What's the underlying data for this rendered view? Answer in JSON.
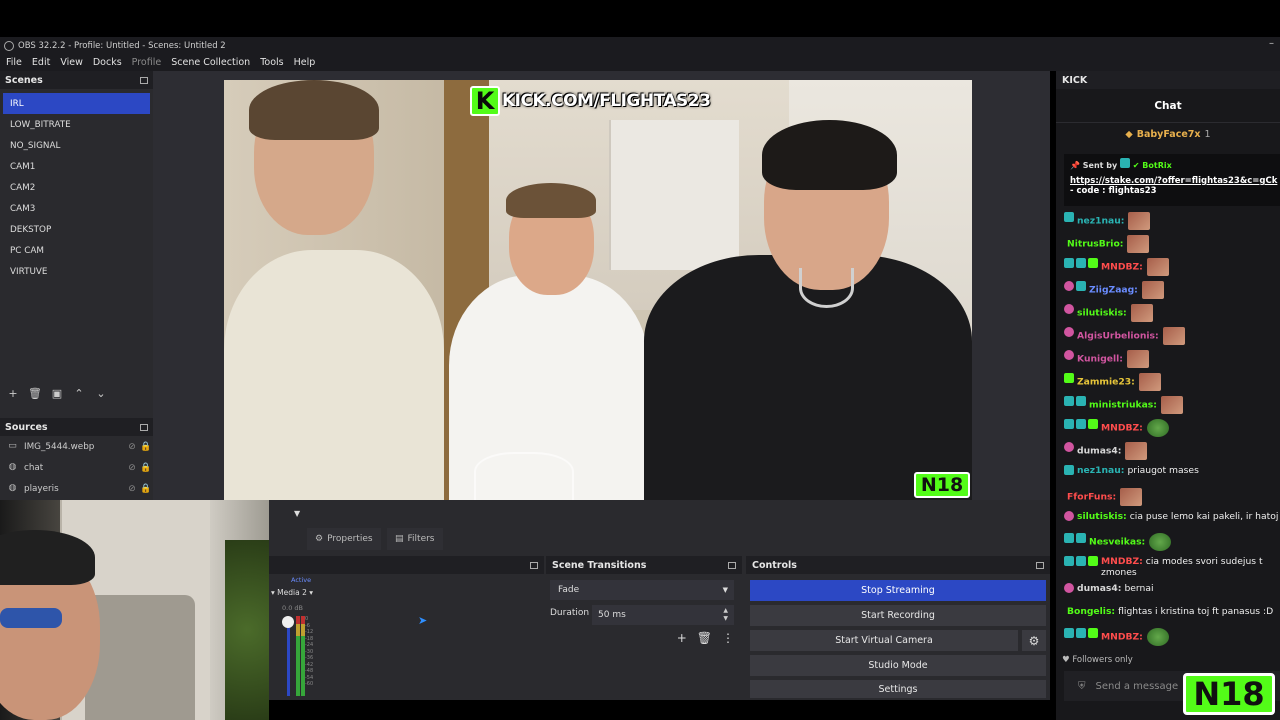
{
  "window": {
    "title": "OBS 32.2.2 - Profile: Untitled - Scenes: Untitled 2"
  },
  "menu": [
    "File",
    "Edit",
    "View",
    "Docks",
    "Profile",
    "Scene Collection",
    "Tools",
    "Help"
  ],
  "scenes": {
    "header": "Scenes",
    "items": [
      "IRL",
      "LOW_BITRATE",
      "NO_SIGNAL",
      "CAM1",
      "CAM2",
      "CAM3",
      "DEKSTOP",
      "PC CAM",
      "VIRTUVE"
    ],
    "selected": "IRL"
  },
  "sources": {
    "header": "Sources",
    "items": [
      {
        "name": "IMG_5444.webp",
        "icon": "image-icon"
      },
      {
        "name": "chat",
        "icon": "globe-icon"
      },
      {
        "name": "playeris",
        "icon": "globe-icon"
      }
    ]
  },
  "preview": {
    "kick_logo": "K",
    "kick_url": "KICK.COM/FLIGHTAS23",
    "n18_label": "N18"
  },
  "source_toolbar": {
    "properties": "Properties",
    "filters": "Filters"
  },
  "mixer": {
    "active_label": "Active",
    "track_name": "Media 2",
    "db": "0.0 dB",
    "ticks": [
      "0",
      "-6",
      "-12",
      "-18",
      "-24",
      "-30",
      "-36",
      "-42",
      "-48",
      "-54",
      "-60"
    ]
  },
  "transitions": {
    "header": "Scene Transitions",
    "selected": "Fade",
    "duration_label": "Duration",
    "duration_value": "50 ms"
  },
  "controls": {
    "header": "Controls",
    "stop_streaming": "Stop Streaming",
    "start_recording": "Start Recording",
    "start_virtual_camera": "Start Virtual Camera",
    "studio_mode": "Studio Mode",
    "settings": "Settings"
  },
  "chat": {
    "dock_title": "KICK",
    "title": "Chat",
    "pinned_user": "BabyFace7x",
    "pinned_count": "1",
    "sent_by_label": "Sent by",
    "bot_name": "BotRix",
    "link": "https://stake.com/?offer=flightas23&c=gCk",
    "code": "- code : flightas23",
    "messages": [
      {
        "user": "nez1nau:",
        "text": "",
        "color": "#2ab3b3",
        "badges": [
          "teal"
        ],
        "emote": true
      },
      {
        "user": "NitrusBrio:",
        "text": "",
        "color": "#53fc18",
        "badges": [],
        "emote": true
      },
      {
        "user": "MNDBZ:",
        "text": "",
        "color": "#ff4d4d",
        "badges": [
          "teal",
          "teal",
          "green"
        ],
        "emote": true
      },
      {
        "user": "ZiigZaag:",
        "text": "",
        "color": "#6a8cff",
        "badges": [
          "pink",
          "teal"
        ],
        "emote": true
      },
      {
        "user": "silutiskis:",
        "text": "",
        "color": "#53fc18",
        "badges": [
          "pink"
        ],
        "emote": true
      },
      {
        "user": "AlgisUrbelionis:",
        "text": "",
        "color": "#d155a0",
        "badges": [
          "pink"
        ],
        "emote": true
      },
      {
        "user": "Kunigell:",
        "text": "",
        "color": "#d155a0",
        "badges": [
          "pink"
        ],
        "emote": true
      },
      {
        "user": "Zammie23:",
        "text": "",
        "color": "#e8c63a",
        "badges": [
          "green"
        ],
        "emote": true
      },
      {
        "user": "ministriukas:",
        "text": "",
        "color": "#53fc18",
        "badges": [
          "teal",
          "teal"
        ],
        "emote": true
      },
      {
        "user": "MNDBZ:",
        "text": "",
        "color": "#ff4d4d",
        "badges": [
          "teal",
          "teal",
          "green"
        ],
        "emote": true,
        "pepe": true
      },
      {
        "user": "dumas4:",
        "text": "",
        "color": "#d8d8d8",
        "badges": [
          "pink"
        ],
        "emote": true
      },
      {
        "user": "nez1nau:",
        "text": "priaugot mases",
        "color": "#2ab3b3",
        "badges": [
          "teal"
        ],
        "emote": false
      },
      {
        "user": "FforFuns:",
        "text": "",
        "color": "#ff4d4d",
        "badges": [],
        "emote": true
      },
      {
        "user": "silutiskis:",
        "text": "cia puse lemo kai pakeli, ir hatoj",
        "color": "#53fc18",
        "badges": [
          "pink"
        ],
        "emote": false
      },
      {
        "user": "Nesveikas:",
        "text": "",
        "color": "#53fc18",
        "badges": [
          "teal",
          "teal"
        ],
        "emote": true,
        "pepe": true
      },
      {
        "user": "MNDBZ:",
        "text": "cia modes svori sudejus t zmones",
        "color": "#ff4d4d",
        "badges": [
          "teal",
          "teal",
          "green"
        ],
        "emote": false
      },
      {
        "user": "dumas4:",
        "text": "bernai",
        "color": "#d8d8d8",
        "badges": [
          "pink"
        ],
        "emote": false
      },
      {
        "user": "Bongelis:",
        "text": "flightas i kristina toj ft panasus :D",
        "color": "#53fc18",
        "badges": [],
        "emote": false
      },
      {
        "user": "MNDBZ:",
        "text": "",
        "color": "#ff4d4d",
        "badges": [
          "teal",
          "teal",
          "green"
        ],
        "emote": true,
        "pepe": true
      }
    ],
    "followers_only": "Followers only",
    "send_placeholder": "Send a message"
  },
  "corner_badge": "N18",
  "colors": {
    "accent_blue": "#2c48c4",
    "kick_green": "#53fc18",
    "panel_bg": "#2a2a2e",
    "chat_bg": "#18181b"
  }
}
